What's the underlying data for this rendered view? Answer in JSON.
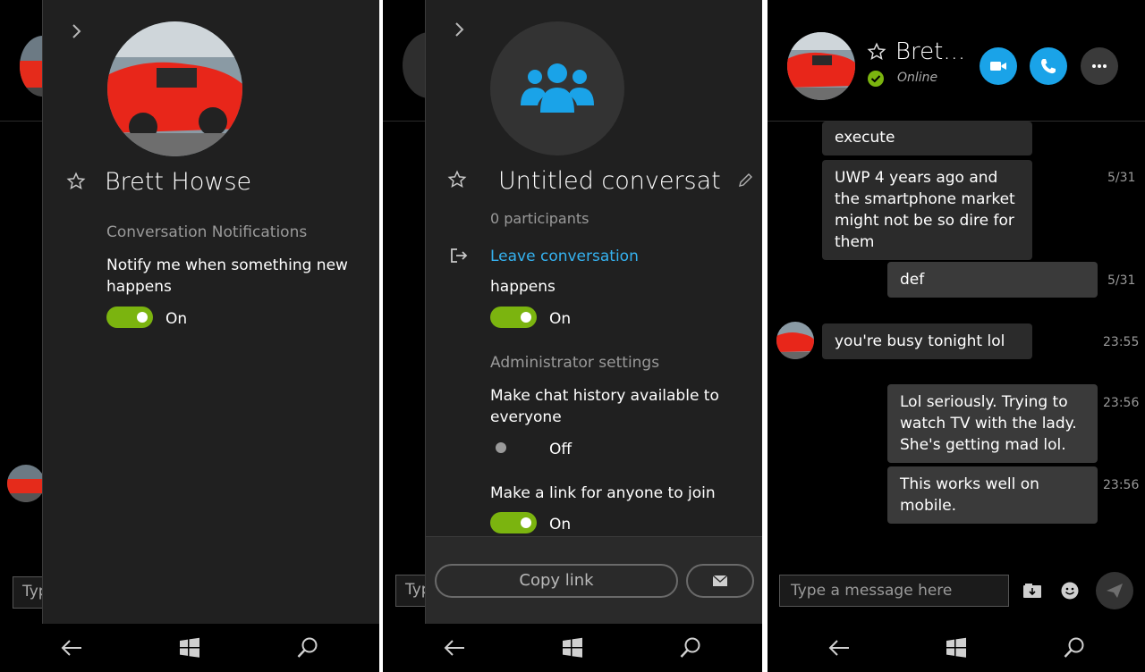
{
  "screen1": {
    "panel": {
      "contact_name": "Brett Howse",
      "section_title": "Conversation Notifications",
      "notify_text": "Notify me when something new happens",
      "toggle_state": "On"
    },
    "background_input_fragment": "Typ"
  },
  "screen2": {
    "panel": {
      "conversation_title": "Untitled conversati...",
      "participants": "0 participants",
      "leave_label": "Leave conversation",
      "happens_fragment": "happens",
      "notify_toggle_state": "On",
      "admin_section_title": "Administrator settings",
      "chat_history_text": "Make chat history available to everyone",
      "chat_history_toggle_state": "Off",
      "link_text": "Make a link for anyone to join",
      "link_toggle_state": "On",
      "copy_link_label": "Copy link"
    },
    "background_input_fragment": "Typ"
  },
  "screen3": {
    "header": {
      "contact_name": "Bret...",
      "status": "Online"
    },
    "messages": [
      {
        "text": "execute",
        "time": "",
        "direction": "in"
      },
      {
        "text": "UWP 4 years ago and the smartphone market might not be so dire for them",
        "time": "5/31",
        "direction": "in"
      },
      {
        "text": "def",
        "time": "5/31",
        "direction": "out"
      },
      {
        "text": "you're busy tonight lol",
        "time": "23:55",
        "direction": "in"
      },
      {
        "text": "Lol seriously. Trying to watch TV with the lady. She's getting mad lol.",
        "time": "23:56",
        "direction": "out"
      },
      {
        "text": "This works well on mobile.",
        "time": "23:56",
        "direction": "out"
      }
    ],
    "composer": {
      "placeholder": "Type a message here"
    }
  },
  "icons": {
    "chevron": "chevron-right-icon",
    "star": "star-outline-icon",
    "group": "group-icon",
    "edit": "pencil-icon",
    "leave": "sign-out-icon",
    "email": "email-icon",
    "video": "video-call-icon",
    "call": "phone-icon",
    "more": "more-dots-icon",
    "attach": "attach-media-icon",
    "emoji": "emoji-icon",
    "send": "send-icon",
    "back": "back-arrow-icon",
    "windows": "windows-logo-icon",
    "search": "search-icon"
  },
  "colors": {
    "accent_blue": "#35b2f0",
    "call_button_blue": "#1aa3e8",
    "toggle_green": "#7bb40f",
    "panel_bg": "#202020",
    "online_green": "#7bb40f"
  }
}
